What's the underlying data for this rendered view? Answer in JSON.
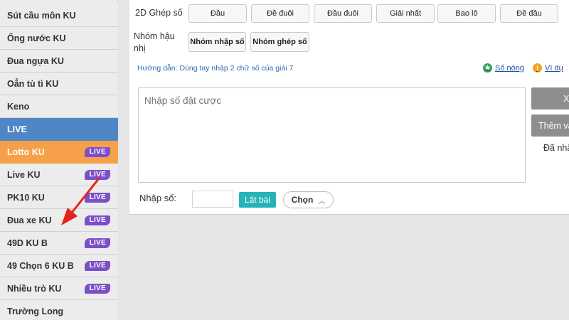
{
  "sidebar": {
    "items": [
      {
        "label": "Sút cầu môn KU",
        "live": "",
        "state": "normal"
      },
      {
        "label": "Ống nước KU",
        "live": "",
        "state": "normal"
      },
      {
        "label": "Đua ngựa KU",
        "live": "",
        "state": "normal"
      },
      {
        "label": "Oẳn tù tì KU",
        "live": "",
        "state": "normal"
      },
      {
        "label": "Keno",
        "live": "",
        "state": "normal"
      },
      {
        "label": "LIVE",
        "live": "",
        "state": "blue"
      },
      {
        "label": "Lotto KU",
        "live": "LIVE",
        "state": "orange"
      },
      {
        "label": "Live KU",
        "live": "LIVE",
        "state": "normal"
      },
      {
        "label": "PK10 KU",
        "live": "LIVE",
        "state": "normal"
      },
      {
        "label": "Đua xe KU",
        "live": "LIVE",
        "state": "normal"
      },
      {
        "label": "49D KU B",
        "live": "LIVE",
        "state": "normal"
      },
      {
        "label": "49 Chọn 6 KU B",
        "live": "LIVE",
        "state": "normal"
      },
      {
        "label": "Nhiều trò KU",
        "live": "LIVE",
        "state": "normal"
      },
      {
        "label": "Trường Long",
        "live": "",
        "state": "normal"
      }
    ]
  },
  "main": {
    "row1_label": "2D Ghép số",
    "row1_buttons": [
      "Đầu",
      "Đề đuôi",
      "Đầu đuôi",
      "Giải nhất",
      "Bao lô",
      "Đề đầu"
    ],
    "row2_label_line1": "Nhóm hậu",
    "row2_label_line2": "nhị",
    "row2_buttons": [
      "Nhóm nhập số",
      "Nhóm ghép số"
    ],
    "guide": "Hướng dẫn:  Dùng tay nhập 2 chữ số của giải 7",
    "hot_numbers": "Số nóng",
    "example": "Ví dụ",
    "textarea_placeholder": "Nhập số đặt cược",
    "input_label": "Nhập số:",
    "flip_button": "Lật bài",
    "choose_button": "Chọn",
    "right_btn1": "X",
    "right_btn2": "Thêm và",
    "right_text": "Đã nhậ"
  },
  "colors": {
    "live_blue": "#4f86c6",
    "lotto_orange": "#f6a04a",
    "live_badge_purple": "#7b4fc9",
    "flip_teal": "#24b3b7",
    "arrow_red": "#e8221b"
  }
}
